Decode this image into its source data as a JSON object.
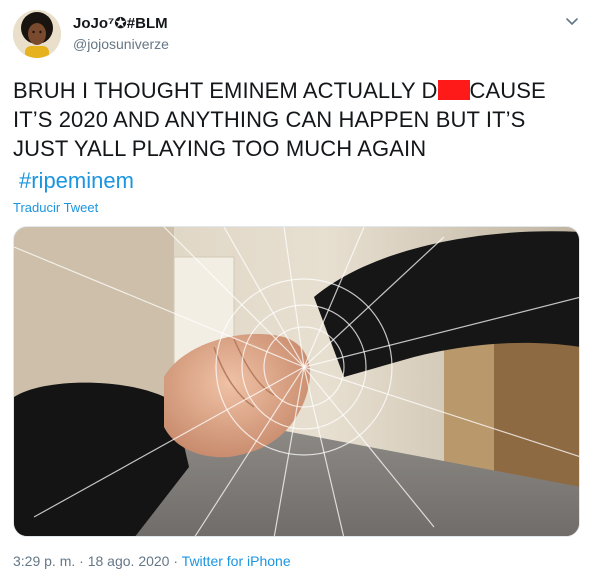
{
  "user": {
    "display_name": "JoJo⁷✪#BLM",
    "handle": "@jojosuniverze"
  },
  "tweet": {
    "text_before": "BRUH I THOUGHT EMINEM ACTUALLY D",
    "text_after": "CAUSE IT’S 2020 AND ANYTHING CAN HAPPEN BUT IT’S JUST YALL PLAYING TOO MUCH AGAIN",
    "hashtag": "#ripeminem",
    "translate_label": "Traducir Tweet"
  },
  "meta": {
    "time": "3:29 p. m.",
    "separator1": "·",
    "date": "18 ago. 2020",
    "separator2": "·",
    "source": "Twitter for iPhone"
  },
  "colors": {
    "link": "#1b95e0",
    "secondary_text": "#657786",
    "censor_block": "#ff1a1a"
  },
  "icons": {
    "menu": "chevron-down-icon"
  }
}
